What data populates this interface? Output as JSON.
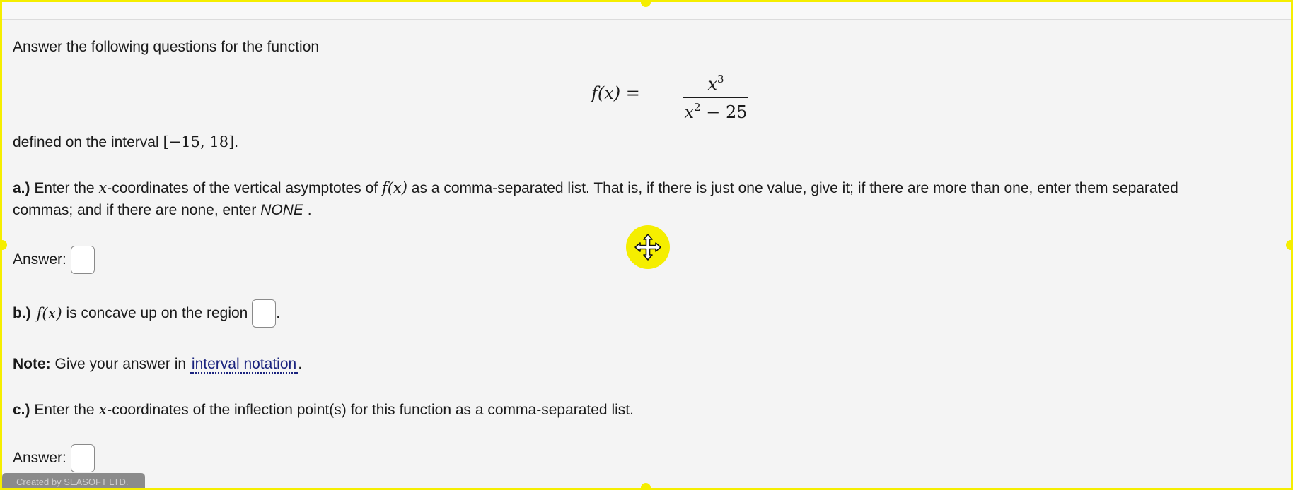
{
  "intro": {
    "text": "Answer the following questions for the function"
  },
  "function": {
    "lhs": "f(x) =",
    "numerator_base": "x",
    "numerator_exp": "3",
    "denominator_base": "x",
    "denominator_exp": "2",
    "denominator_rest": " − 25"
  },
  "interval": {
    "prefix": "defined on the interval ",
    "math": "[−15, 18]",
    "suffix": "."
  },
  "part_a": {
    "label": "a.)",
    "text_1": " Enter the ",
    "var_x": "x",
    "text_2": "-coordinates of the vertical asymptotes of ",
    "func": "f(x)",
    "text_3": " as a comma-separated list. That is, if there is just one value, give it; if there are more than one, enter them separated",
    "text_4": "commas; and if there are none, enter ",
    "none": "NONE",
    "text_5": " .",
    "answer_label": "Answer:",
    "answer_value": ""
  },
  "part_b": {
    "label": "b.)",
    "func": "f(x)",
    "text_1": " is concave up on the region ",
    "text_2": ".",
    "answer_value": ""
  },
  "note": {
    "label": "Note:",
    "text": " Give your answer in ",
    "link": "interval notation",
    "suffix": "."
  },
  "part_c": {
    "label": "c.)",
    "text_1": " Enter the ",
    "var_x": "x",
    "text_2": "-coordinates of the inflection point(s) for this function as a comma-separated list.",
    "answer_label": "Answer:",
    "answer_value": ""
  },
  "footer": {
    "text": "Created by SEASOFT LTD."
  },
  "icons": {
    "move_cursor": "move-cursor-icon"
  },
  "colors": {
    "highlight": "#f5ee00",
    "link": "#1a237e",
    "background": "#f4f4f4"
  }
}
